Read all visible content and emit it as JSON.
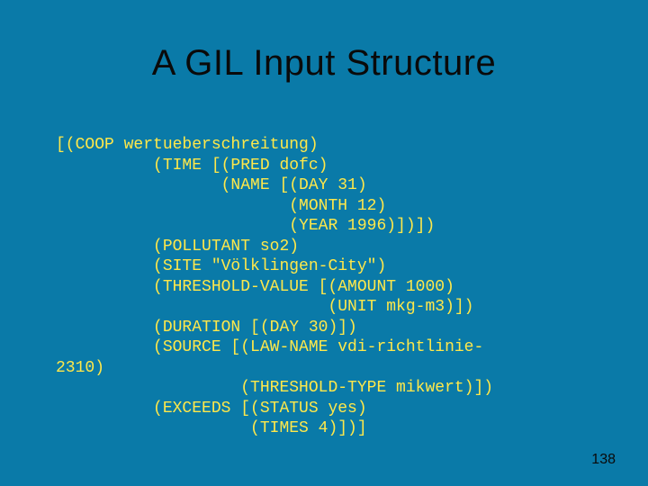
{
  "slide": {
    "title": "A GIL Input Structure",
    "page_number": "138"
  },
  "code": {
    "l01": "[(COOP wertueberschreitung)",
    "l02": "          (TIME [(PRED dofc)",
    "l03": "                 (NAME [(DAY 31)",
    "l04": "                        (MONTH 12)",
    "l05": "                        (YEAR 1996)])])",
    "l06": "          (POLLUTANT so2)",
    "l07": "          (SITE \"Völklingen-City\")",
    "l08": "          (THRESHOLD-VALUE [(AMOUNT 1000)",
    "l09": "                            (UNIT mkg-m3)])",
    "l10": "          (DURATION [(DAY 30)])",
    "l11": "          (SOURCE [(LAW-NAME vdi-richtlinie-",
    "l12": "2310)",
    "l13": "                   (THRESHOLD-TYPE mikwert)])",
    "l14": "          (EXCEEDS [(STATUS yes)",
    "l15": "                    (TIMES 4)])]"
  }
}
